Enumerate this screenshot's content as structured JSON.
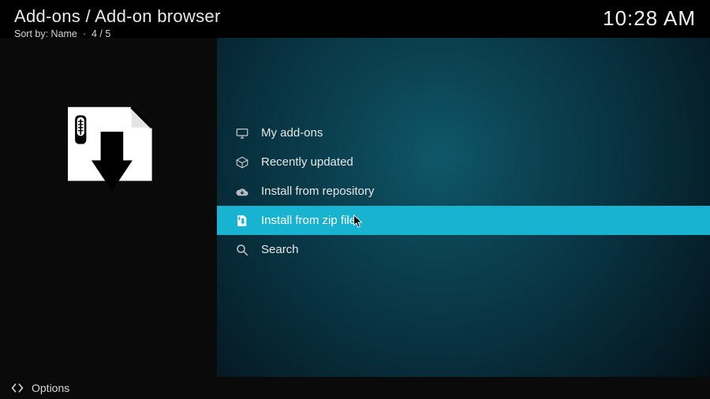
{
  "header": {
    "breadcrumb": "Add-ons / Add-on browser",
    "sort_label": "Sort by: Name",
    "position": "4 / 5",
    "clock": "10:28 AM"
  },
  "menu": {
    "items": [
      {
        "label": "My add-ons",
        "icon": "monitor-icon"
      },
      {
        "label": "Recently updated",
        "icon": "box-icon"
      },
      {
        "label": "Install from repository",
        "icon": "cloud-download-icon"
      },
      {
        "label": "Install from zip file",
        "icon": "zip-download-icon"
      },
      {
        "label": "Search",
        "icon": "search-icon"
      }
    ],
    "selected_index": 3
  },
  "footer": {
    "options_label": "Options"
  }
}
